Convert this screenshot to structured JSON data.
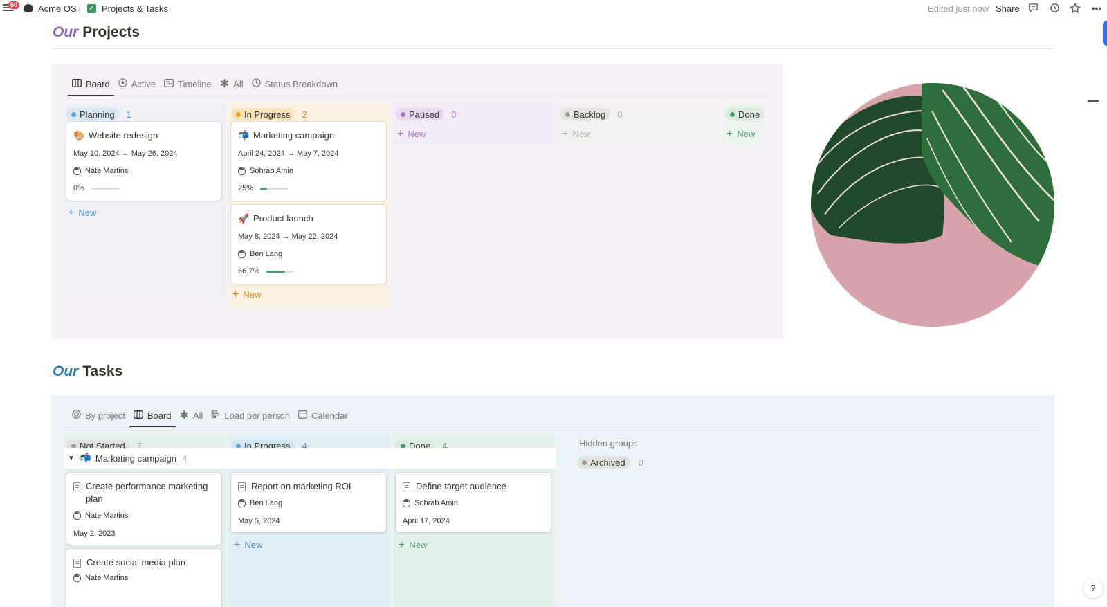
{
  "topbar": {
    "notification_count": "60",
    "workspace": "Acme OS",
    "separator": "/",
    "page": "Projects & Tasks",
    "edited": "Edited just now",
    "share_label": "Share"
  },
  "projects": {
    "heading_em": "Our",
    "heading": "Projects",
    "tabs": [
      "Board",
      "Active",
      "Timeline",
      "All",
      "Status Breakdown"
    ],
    "columns": [
      {
        "label": "Planning",
        "count": "1",
        "color": "#5b9fd6",
        "pill_bg": "#d8e7f4",
        "bg": "#eef0f6",
        "count_color": "#4a8cc4"
      },
      {
        "label": "In Progress",
        "count": "2",
        "color": "#e3a018",
        "pill_bg": "#f8e2b8",
        "bg": "#faf1e3",
        "count_color": "#c98e1a"
      },
      {
        "label": "Paused",
        "count": "0",
        "color": "#a873c7",
        "pill_bg": "#ead8f1",
        "bg": "#f3ecf6",
        "count_color": "#a873c7"
      },
      {
        "label": "Backlog",
        "count": "0",
        "color": "#9b9a97",
        "pill_bg": "#e6e5e3",
        "bg": "#f1f0ee",
        "count_color": "#b0afac"
      },
      {
        "label": "Done",
        "count": "",
        "color": "#4a9a6a",
        "pill_bg": "#dcebe0",
        "bg": "#ecf3ec",
        "count_color": "#4a9a6a"
      }
    ],
    "cards": [
      {
        "title": "Website redesign",
        "icon": "🎨",
        "dates": "May 10, 2024 → May 26, 2024",
        "owner": "Nate Martins",
        "progress_label": "0%",
        "progress": 0
      },
      {
        "title": "Marketing campaign",
        "icon": "📬",
        "dates": "April 24, 2024 → May 7, 2024",
        "owner": "Sohrab Amin",
        "progress_label": "25%",
        "progress": 0.25
      },
      {
        "title": "Product launch",
        "icon": "🚀",
        "dates": "May 8, 2024 → May 22, 2024",
        "owner": "Ben Lang",
        "progress_label": "66.7%",
        "progress": 0.667
      }
    ],
    "new_label": "New"
  },
  "tasks": {
    "heading_em": "Our",
    "heading": "Tasks",
    "tabs": [
      "By project",
      "Board",
      "All",
      "Load per person",
      "Calendar"
    ],
    "columns": [
      {
        "label": "Not Started",
        "count": "7",
        "color": "#9b9a97",
        "pill_bg": "#e3e2e0",
        "count_color": "#b0afac"
      },
      {
        "label": "In Progress",
        "count": "4",
        "color": "#5b9fd6",
        "pill_bg": "#d3e5f3",
        "count_color": "#4a8cc4"
      },
      {
        "label": "Done",
        "count": "4",
        "color": "#4a9a6a",
        "pill_bg": "#d9ecdf",
        "count_color": "#4a9a6a"
      }
    ],
    "group": {
      "caret": "▼",
      "icon": "📬",
      "label": "Marketing campaign",
      "count": "4"
    },
    "hidden_groups": "Hidden groups",
    "archived": {
      "label": "Archived",
      "count": "0"
    },
    "cards": [
      {
        "title": "Create performance marketing plan",
        "owner": "Nate Martins",
        "date": "May 2, 2023"
      },
      {
        "title": "Create social media plan",
        "owner": "Nate Martins",
        "date": ""
      },
      {
        "title": "Report on marketing ROI",
        "owner": "Ben Lang",
        "date": "May 5, 2024"
      },
      {
        "title": "Define target audience",
        "owner": "Sohrab Amin",
        "date": "April 17, 2024"
      }
    ],
    "new_label": "New"
  }
}
